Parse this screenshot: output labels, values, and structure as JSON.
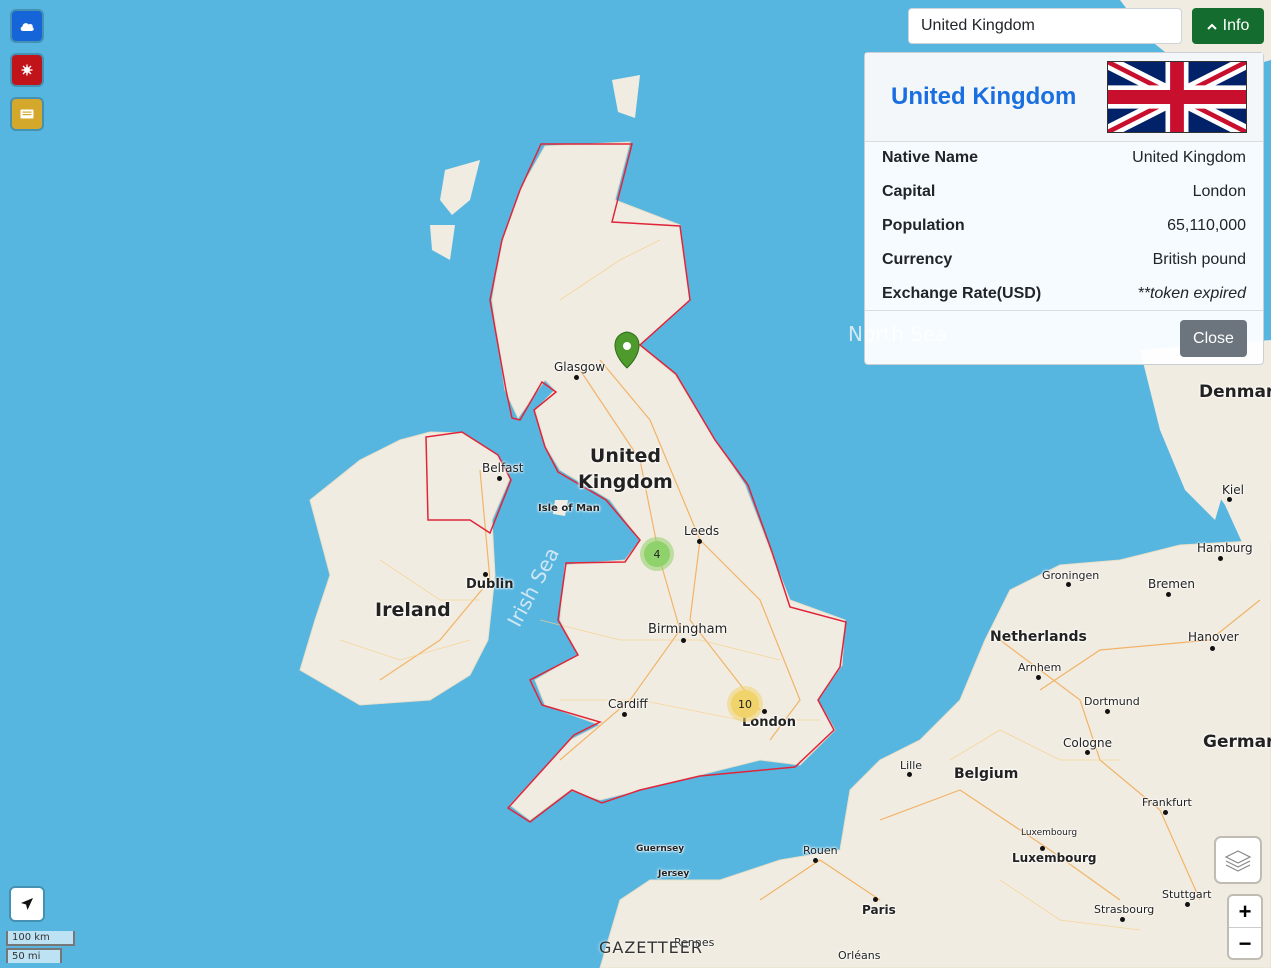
{
  "map": {
    "country_labels": {
      "uk_line1": "United",
      "uk_line2": "Kingdom",
      "ireland": "Ireland",
      "denmark": "Denmar",
      "germany": "Germar",
      "netherlands": "Netherlands",
      "belgium": "Belgium"
    },
    "sea_labels": {
      "irish_sea": "Irish Sea",
      "north_sea": "North Sea"
    },
    "cities": {
      "glasgow": "Glasgow",
      "belfast": "Belfast",
      "isle_of_man": "Isle of Man",
      "leeds": "Leeds",
      "dublin": "Dublin",
      "birmingham": "Birmingham",
      "cardiff": "Cardiff",
      "london": "London",
      "kiel": "Kiel",
      "hamburg": "Hamburg",
      "groningen": "Groningen",
      "bremen": "Bremen",
      "hanover": "Hanover",
      "arnhem": "Arnhem",
      "dortmund": "Dortmund",
      "cologne": "Cologne",
      "lille": "Lille",
      "frankfurt": "Frankfurt",
      "luxembourg_small": "Luxembourg",
      "luxembourg": "Luxembourg",
      "rouen": "Rouen",
      "paris": "Paris",
      "strasbourg": "Strasbourg",
      "stuttgart": "Stuttgart",
      "guernsey": "Guernsey",
      "jersey": "Jersey",
      "rennes": "Rennes",
      "orleans": "Orléans"
    },
    "clusters": [
      {
        "count": "4",
        "color": "#8fd16a"
      },
      {
        "count": "10",
        "color": "#f0d36b"
      }
    ],
    "border_color": "#e0253a",
    "marker_color": "#4e9a2d"
  },
  "controls": {
    "left_buttons": [
      {
        "icon": "cloud-icon",
        "color": "#1565d8"
      },
      {
        "icon": "virus-icon",
        "color": "#c0131a"
      },
      {
        "icon": "news-icon",
        "color": "#d4a82a"
      }
    ],
    "scale_km": "100 km",
    "scale_mi": "50 mi",
    "zoom_in": "+",
    "zoom_out": "−",
    "watermark": "GAZETTEER"
  },
  "search": {
    "value": "United Kingdom"
  },
  "info_button": {
    "label": "Info",
    "color": "#146c2e"
  },
  "panel": {
    "title": "United Kingdom",
    "rows": [
      {
        "key": "Native Name",
        "value": "United Kingdom"
      },
      {
        "key": "Capital",
        "value": "London"
      },
      {
        "key": "Population",
        "value": "65,110,000"
      },
      {
        "key": "Currency",
        "value": "British pound"
      },
      {
        "key": "Exchange Rate(USD)",
        "value": "**token expired"
      }
    ],
    "close_label": "Close"
  }
}
